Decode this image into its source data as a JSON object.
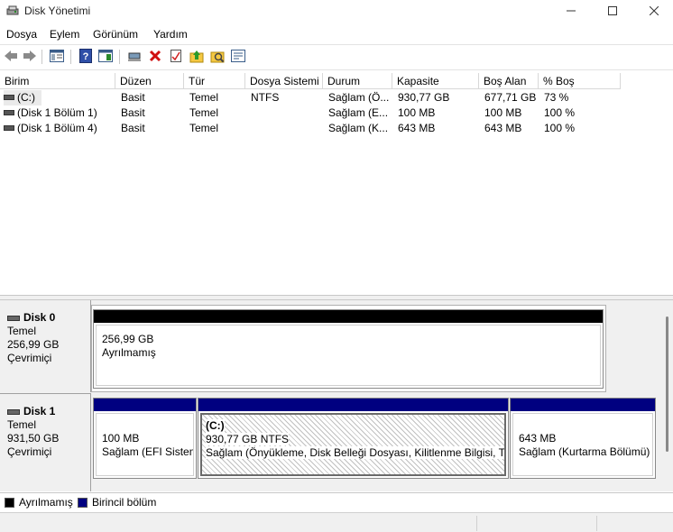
{
  "window": {
    "title": "Disk Yönetimi",
    "icons": {
      "app": "disk-management-icon",
      "minimize": "minimize-icon",
      "maximize": "maximize-icon",
      "close": "close-icon"
    }
  },
  "menu": {
    "items": [
      "Dosya",
      "Eylem",
      "Görünüm",
      "Yardım"
    ]
  },
  "toolbar": {
    "icons": [
      "back-arrow-icon",
      "forward-arrow-icon",
      "console-tree-icon",
      "help-icon",
      "show-action-pane-icon",
      "connect-icon",
      "delete-icon",
      "properties-icon",
      "up-folder-icon",
      "rescan-icon",
      "settings-icon"
    ]
  },
  "volume_list": {
    "columns": [
      "Birim",
      "Düzen",
      "Tür",
      "Dosya Sistemi",
      "Durum",
      "Kapasite",
      "Boş Alan",
      "% Boş"
    ],
    "rows": [
      [
        "(C:)",
        "Basit",
        "Temel",
        "NTFS",
        "Sağlam (Ö...",
        "930,77 GB",
        "677,71 GB",
        "73 %"
      ],
      [
        "(Disk 1 Bölüm 1)",
        "Basit",
        "Temel",
        "",
        "Sağlam (E...",
        "100 MB",
        "100 MB",
        "100 %"
      ],
      [
        "(Disk 1 Bölüm 4)",
        "Basit",
        "Temel",
        "",
        "Sağlam (K...",
        "643 MB",
        "643 MB",
        "100 %"
      ]
    ]
  },
  "disks": [
    {
      "name": "Disk 0",
      "type": "Temel",
      "size": "256,99 GB",
      "status": "Çevrimiçi",
      "partitions": [
        {
          "line1": "256,99 GB",
          "line2": "Ayrılmamış",
          "bar_color": "#000000"
        }
      ]
    },
    {
      "name": "Disk 1",
      "type": "Temel",
      "size": "931,50 GB",
      "status": "Çevrimiçi",
      "partitions": [
        {
          "line1": "100 MB",
          "line2": "Sağlam (EFI Sistem",
          "bar_color": "#000080"
        },
        {
          "title": "(C:)",
          "line1": "930,77 GB NTFS",
          "line2": "Sağlam (Önyükleme, Disk Belleği Dosyası, Kilitlenme Bilgisi, Ter",
          "bar_color": "#000080"
        },
        {
          "line1": "643 MB",
          "line2": "Sağlam (Kurtarma Bölümü)",
          "bar_color": "#000080"
        }
      ]
    }
  ],
  "legend": [
    {
      "label": "Ayrılmamış",
      "color": "#000000"
    },
    {
      "label": "Birincil bölüm",
      "color": "#000080"
    }
  ]
}
